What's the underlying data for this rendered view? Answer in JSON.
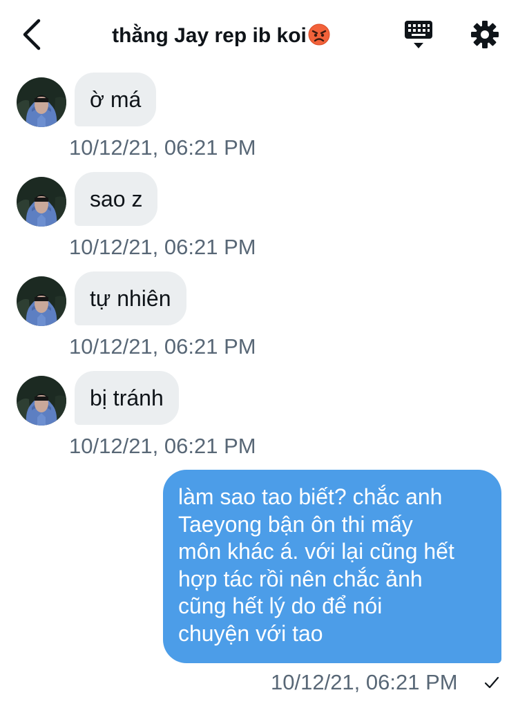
{
  "header": {
    "title": "thằng Jay rep ib koi",
    "back_icon": "chevron-left-icon",
    "keyboard_icon": "keyboard-icon",
    "settings_icon": "gear-icon",
    "emoji_icon": "angry-face-emoji"
  },
  "conversation": {
    "incoming": [
      {
        "text": "ờ má",
        "time": "10/12/21, 06:21 PM"
      },
      {
        "text": "sao z",
        "time": "10/12/21, 06:21 PM"
      },
      {
        "text": "tự nhiên",
        "time": "10/12/21, 06:21 PM"
      },
      {
        "text": "bị tránh",
        "time": "10/12/21, 06:21 PM"
      }
    ],
    "outgoing": {
      "lines": [
        "làm sao tao biết? chắc anh",
        "Taeyong bận ôn thi mấy",
        "môn khác á. với lại cũng hết",
        "hợp tác rồi nên chắc ảnh",
        "cũng hết lý do để nói",
        "chuyện với tao"
      ],
      "time": "10/12/21, 06:21 PM",
      "status_icon": "checkmark-icon"
    }
  },
  "colors": {
    "incoming_bubble": "#ebeef0",
    "outgoing_bubble": "#4c9de8",
    "timestamp": "#586776",
    "text": "#0f1419"
  }
}
